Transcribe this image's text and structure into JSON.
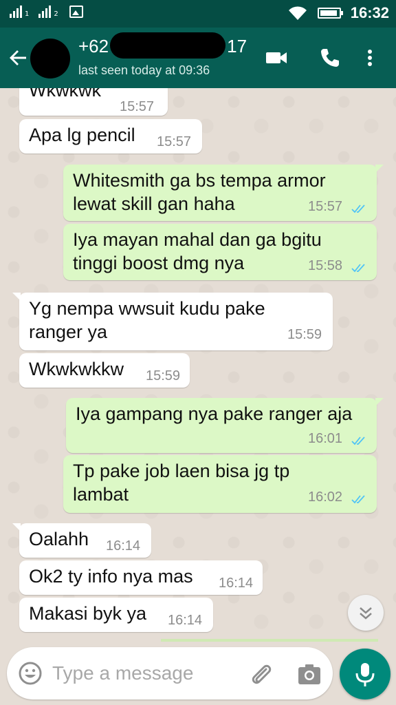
{
  "status_bar": {
    "sim1_label": "1",
    "sim2_label": "2",
    "clock": "16:32",
    "battery_level": 0.95
  },
  "header": {
    "title_prefix": "+62",
    "title_suffix": "17",
    "last_seen": "last seen today at 09:36"
  },
  "messages": [
    {
      "direction": "in",
      "text": "Wkwkwk",
      "time": "15:57"
    },
    {
      "direction": "in",
      "text": "Apa lg pencil",
      "time": "15:57"
    },
    {
      "direction": "out",
      "text": "Whitesmith ga bs tempa armor\nlewat skill gan haha",
      "time": "15:57",
      "status": "read"
    },
    {
      "direction": "out",
      "text": "Iya mayan mahal dan ga bgitu\ntinggi boost dmg nya",
      "time": "15:58",
      "status": "read"
    },
    {
      "direction": "in",
      "text": "Yg nempa wwsuit kudu pake\nranger ya",
      "time": "15:59"
    },
    {
      "direction": "in",
      "text": "Wkwkwkkw",
      "time": "15:59"
    },
    {
      "direction": "out",
      "text": "Iya gampang nya pake ranger aja",
      "time": "16:01",
      "status": "read"
    },
    {
      "direction": "out",
      "text": "Tp pake job laen bisa jg tp\nlambat",
      "time": "16:02",
      "status": "read"
    },
    {
      "direction": "in",
      "text": "Oalahh",
      "time": "16:14"
    },
    {
      "direction": "in",
      "text": "Ok2 ty info nya mas",
      "time": "16:14"
    },
    {
      "direction": "in",
      "text": "Makasi byk ya",
      "time": "16:14"
    }
  ],
  "composer": {
    "placeholder": "Type a message"
  },
  "colors": {
    "header": "#075e54",
    "status_bar": "#054d44",
    "outgoing": "#dcf8c6",
    "incoming": "#ffffff",
    "read_ticks": "#4fc3f7",
    "fab": "#00897b"
  },
  "icons": [
    "back-arrow-icon",
    "video-call-icon",
    "phone-icon",
    "more-vert-icon",
    "emoji-icon",
    "attach-icon",
    "camera-icon",
    "mic-icon",
    "chevron-double-down-icon",
    "wifi-icon",
    "signal-icon",
    "gallery-icon",
    "battery-icon",
    "double-check-icon"
  ]
}
